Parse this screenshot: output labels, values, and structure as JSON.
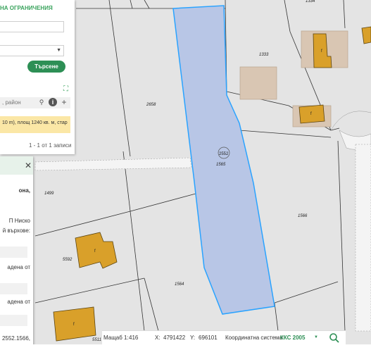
{
  "search": {
    "title": "НА ОГРАНИЧЕНИЯ",
    "search_button": "Търсене",
    "result_hint": ", район",
    "result_row": "10 m), площ 1240 кв. м, стар",
    "pager": "1 - 1 от 1 записи"
  },
  "details": {
    "line1": "она,",
    "line2": "П   Ниско",
    "line3": "й върхове:",
    "line4": "адена   от",
    "line5": "адена   от",
    "line6": "2552.1566,"
  },
  "map": {
    "parcel_labels": [
      "1334",
      "1333",
      "2658",
      "2552",
      "1565",
      "1499",
      "1566",
      "5592",
      "1564",
      "5511"
    ],
    "building_label": "f",
    "highlight_color": "#b8c6e6",
    "highlight_border": "#2aa3ff",
    "building_color": "#d9a02a"
  },
  "status": {
    "scale_label": "Мащаб 1:",
    "scale_value": "416",
    "x_label": "X:",
    "x_value": "4791422",
    "y_label": "Y:",
    "y_value": "696101",
    "coord_sys_label": "Координатна система:",
    "coord_sys_value": "ККС 2005"
  }
}
